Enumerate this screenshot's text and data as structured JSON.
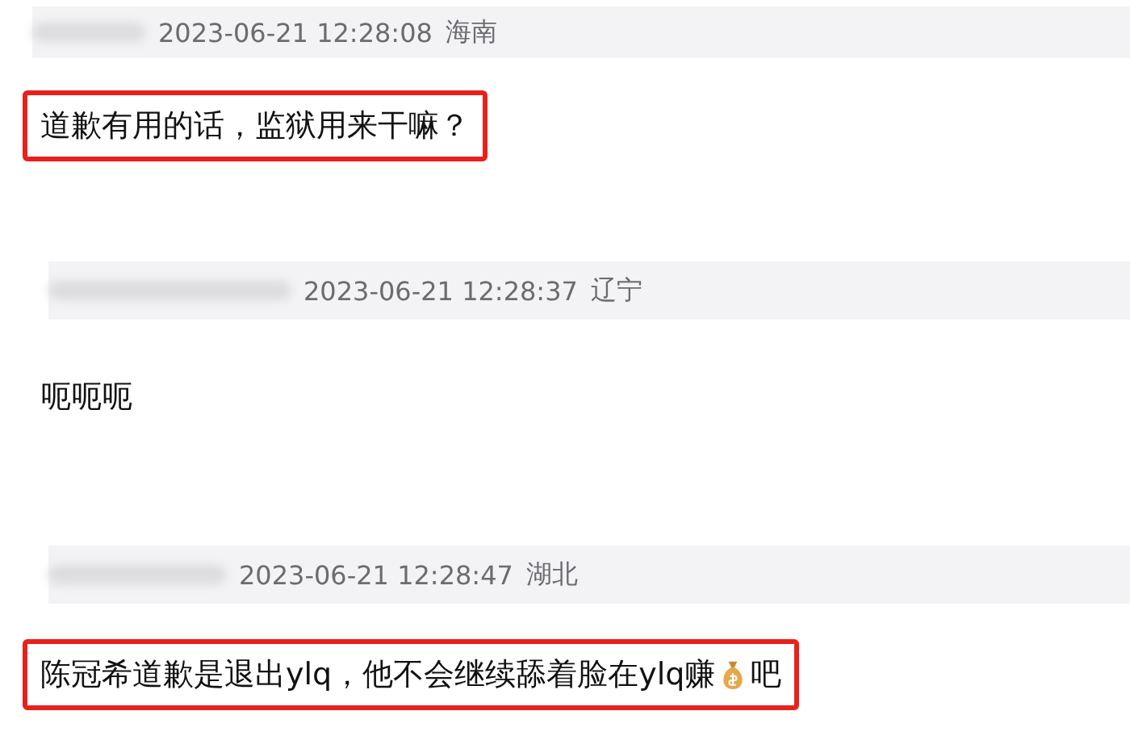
{
  "comments": [
    {
      "timestamp": "2023-06-21 12:28:08",
      "region": "海南",
      "highlighted": true,
      "segments": [
        {
          "kind": "text",
          "text": "道歉有用的话，监狱用来干嘛？"
        }
      ]
    },
    {
      "timestamp": "2023-06-21 12:28:37",
      "region": "辽宁",
      "highlighted": false,
      "segments": [
        {
          "kind": "text",
          "text": "呃呃呃"
        }
      ]
    },
    {
      "timestamp": "2023-06-21 12:28:47",
      "region": "湖北",
      "highlighted": true,
      "segments": [
        {
          "kind": "text",
          "text": "陈冠希道歉是退出ylq，他不会继续舔着脸在ylq赚"
        },
        {
          "kind": "emoji"
        },
        {
          "kind": "text",
          "text": "吧"
        }
      ]
    }
  ]
}
